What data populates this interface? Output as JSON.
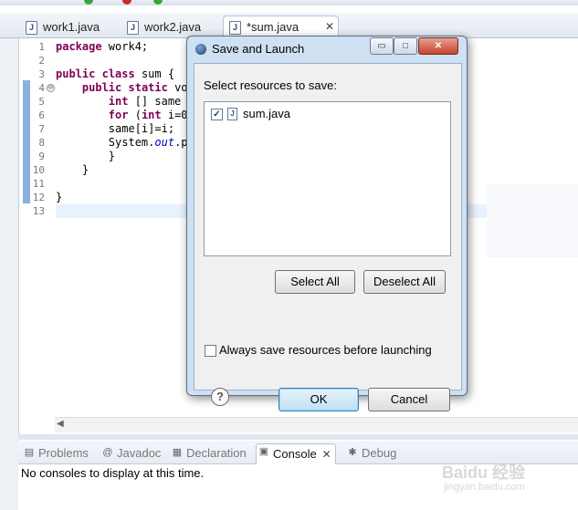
{
  "editor_tabs": [
    {
      "label": "work1.java",
      "icon": "java-file-icon"
    },
    {
      "label": "work2.java",
      "icon": "java-file-icon"
    },
    {
      "label": "*sum.java",
      "icon": "java-file-icon",
      "active": true
    }
  ],
  "code": {
    "line_numbers": [
      "1",
      "2",
      "3",
      "4",
      "5",
      "6",
      "7",
      "8",
      "9",
      "10",
      "11",
      "12",
      "13"
    ],
    "lines": [
      "package work4;",
      "",
      "public class sum {",
      "    public static vo",
      "        int [] same",
      "        for (int i=0",
      "        same[i]=i;",
      "        System.out.p",
      "        }",
      "    }",
      "",
      "}",
      ""
    ]
  },
  "dialog": {
    "title": "Save and Launch",
    "window_buttons": {
      "minimize": "▭",
      "maximize": "□",
      "close": "✕"
    },
    "prompt": "Select resources to save:",
    "resources": [
      {
        "label": "sum.java",
        "checked": true,
        "icon": "java-file-icon"
      }
    ],
    "select_all_label": "Select All",
    "deselect_all_label": "Deselect All",
    "always_save_label": "Always save resources before launching",
    "always_save_checked": false,
    "help_label": "?",
    "ok_label": "OK",
    "cancel_label": "Cancel"
  },
  "bottom_panel": {
    "tabs": [
      {
        "label": "Problems",
        "icon": "problems-icon"
      },
      {
        "label": "Javadoc",
        "icon": "at-icon"
      },
      {
        "label": "Declaration",
        "icon": "declaration-icon"
      },
      {
        "label": "Console",
        "icon": "console-icon",
        "active": true
      },
      {
        "label": "Debug",
        "icon": "debug-icon"
      }
    ],
    "console_message": "No consoles to display at this time."
  },
  "watermark": {
    "text": "Baidu 经验",
    "sub": "jingyan.baidu.com"
  },
  "colors": {
    "keyword": "#7f0055",
    "static_field": "#0000c0",
    "dialog_frame": "#cfe0f3",
    "default_button": "#bfe0f4"
  }
}
